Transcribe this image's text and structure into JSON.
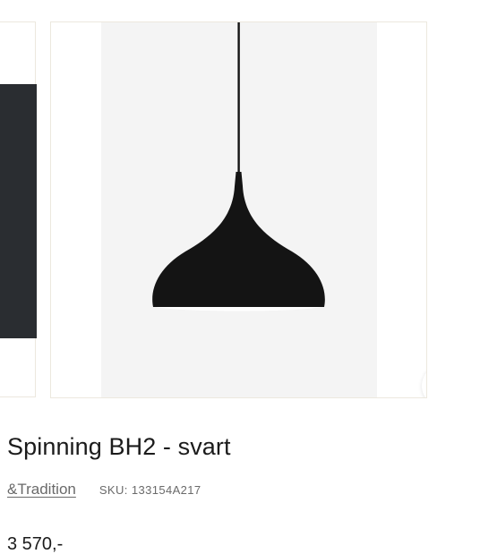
{
  "gallery": {
    "zoom_icon": "magnifier-icon",
    "lamp_color": "#141414",
    "background_color": "#f4f4f4"
  },
  "product": {
    "title": "Spinning BH2 - svart",
    "brand": "&Tradition",
    "sku_label": "SKU:",
    "sku_value": "133154A217",
    "price": "3 570,-"
  }
}
